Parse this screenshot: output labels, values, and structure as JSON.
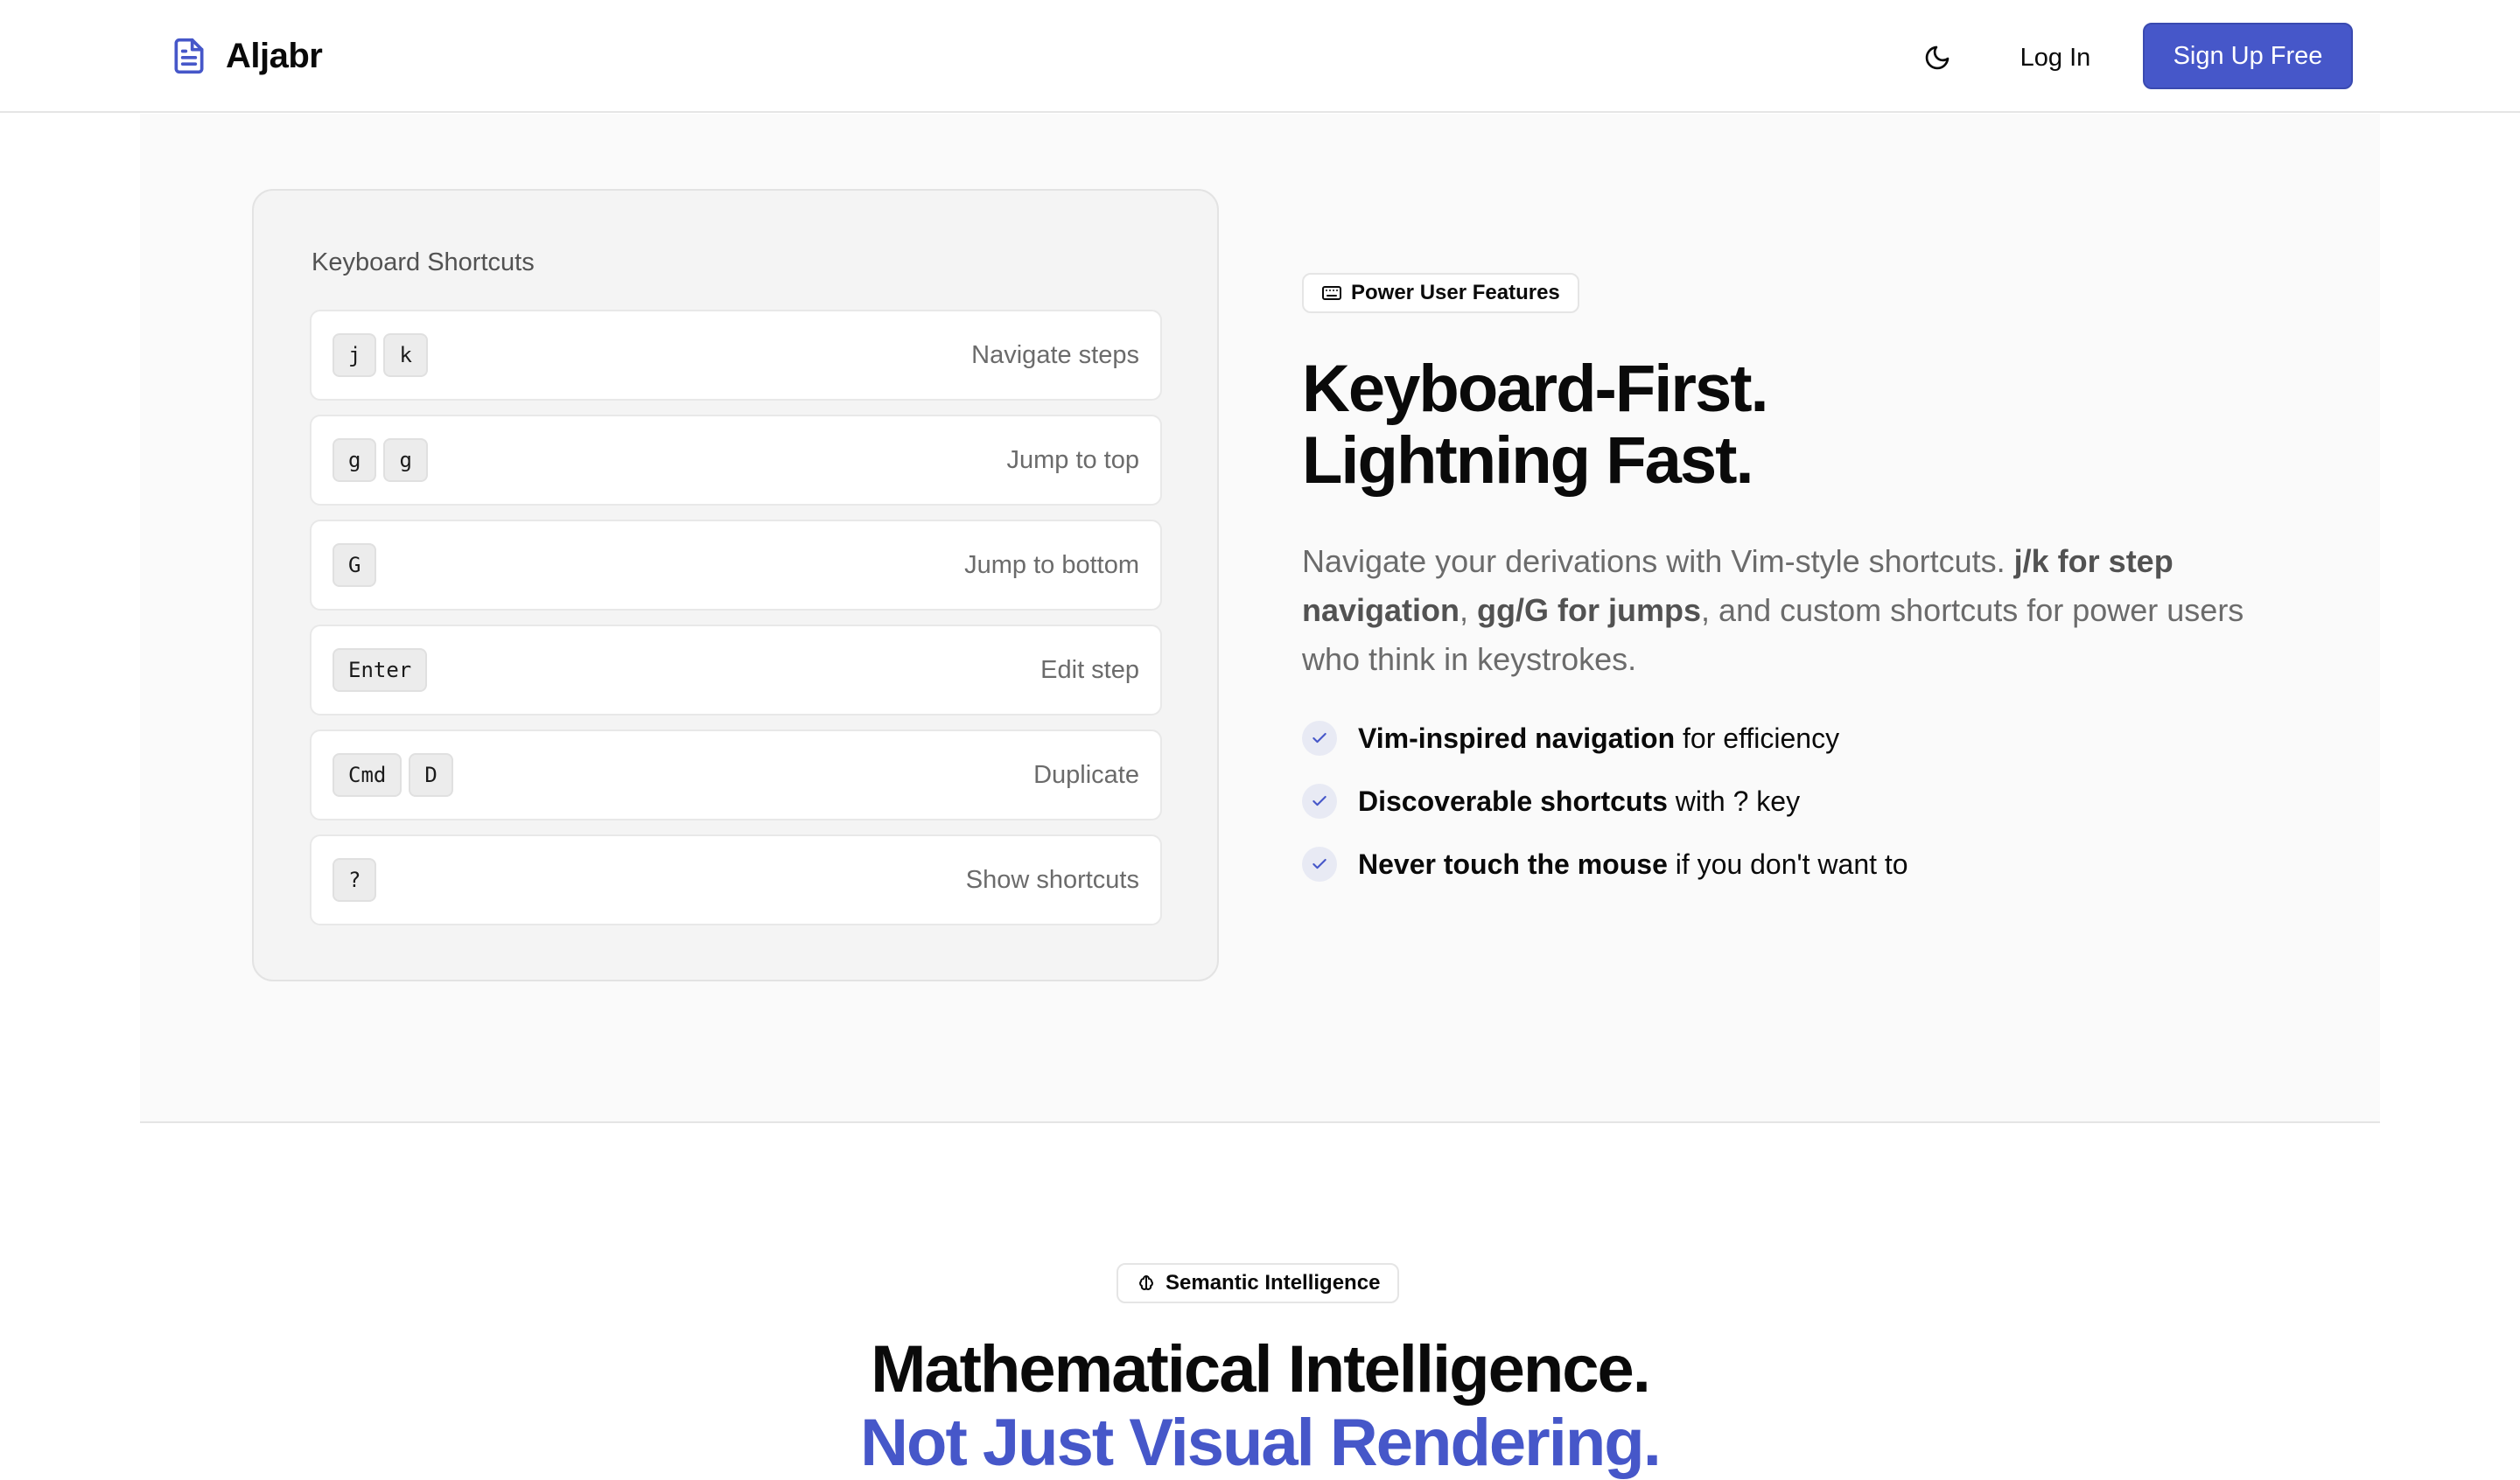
{
  "brand": {
    "name": "Aljabr",
    "accent_color": "#4657c9",
    "icon": "document-icon"
  },
  "nav": {
    "theme_icon": "moon-icon",
    "login_label": "Log In",
    "signup_label": "Sign Up Free"
  },
  "shortcuts_card": {
    "title": "Keyboard Shortcuts",
    "rows": [
      {
        "keys": [
          "j",
          "k"
        ],
        "label": "Navigate steps"
      },
      {
        "keys": [
          "g",
          "g"
        ],
        "label": "Jump to top"
      },
      {
        "keys": [
          "G"
        ],
        "label": "Jump to bottom"
      },
      {
        "keys": [
          "Enter"
        ],
        "label": "Edit step"
      },
      {
        "keys": [
          "Cmd",
          "D"
        ],
        "label": "Duplicate"
      },
      {
        "keys": [
          "?"
        ],
        "label": "Show shortcuts"
      }
    ]
  },
  "feature": {
    "badge": "Power User Features",
    "badge_icon": "keyboard-icon",
    "headline_line1": "Keyboard-First.",
    "headline_line2": "Lightning Fast.",
    "lead": {
      "part1": "Navigate your derivations with Vim-style shortcuts. ",
      "bold1": "j/k for step navigation",
      "part2": ", ",
      "bold2": "gg/G for jumps",
      "part3": ", and custom shortcuts for power users who think in keystrokes."
    },
    "bullets": [
      {
        "bold": "Vim-inspired navigation",
        "rest": " for efficiency"
      },
      {
        "bold": "Discoverable shortcuts",
        "rest": " with ? key"
      },
      {
        "bold": "Never touch the mouse",
        "rest": " if you don't want to"
      }
    ]
  },
  "next_section": {
    "badge": "Semantic Intelligence",
    "badge_icon": "brain-icon",
    "headline_line1": "Mathematical Intelligence.",
    "headline_line2": "Not Just Visual Rendering."
  }
}
